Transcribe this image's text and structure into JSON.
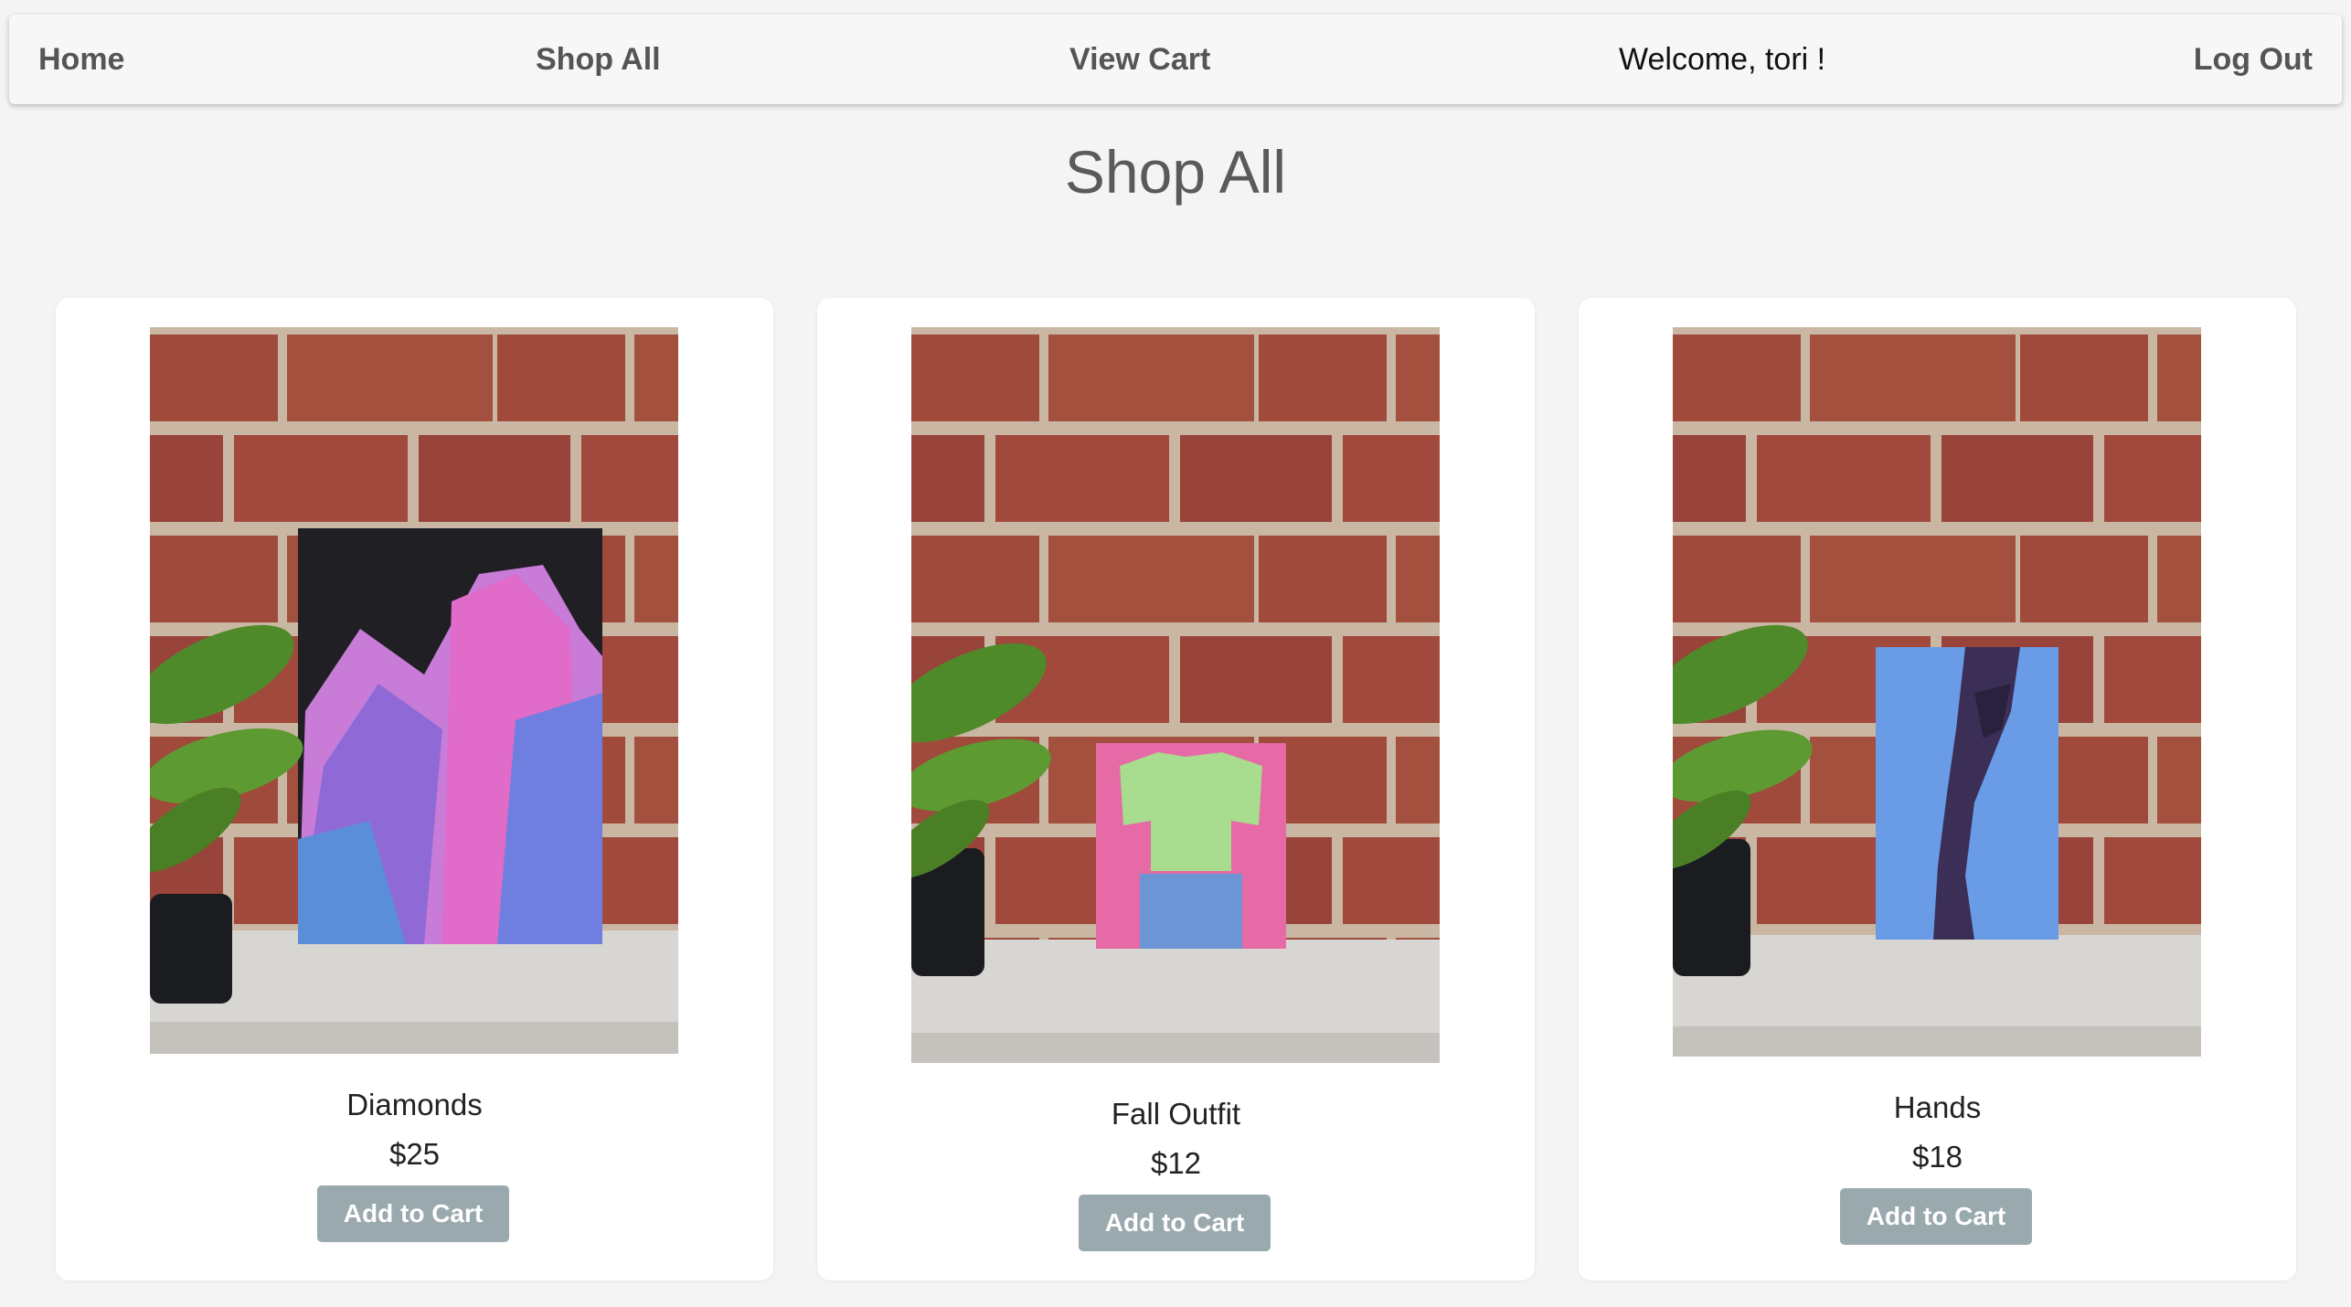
{
  "nav": {
    "home": "Home",
    "shop_all": "Shop All",
    "view_cart": "View Cart",
    "welcome": "Welcome, tori !",
    "logout": "Log Out"
  },
  "page": {
    "title": "Shop All"
  },
  "products": [
    {
      "name": "Diamonds",
      "price": "$25",
      "button": "Add to Cart",
      "image": "crystals-artwork-photo"
    },
    {
      "name": "Fall Outfit",
      "price": "$12",
      "button": "Add to Cart",
      "image": "outfit-artwork-photo"
    },
    {
      "name": "Hands",
      "price": "$18",
      "button": "Add to Cart",
      "image": "hands-artwork-photo"
    }
  ],
  "colors": {
    "page_bg": "#f4f4f4",
    "navbar_bg": "#f7f7f7",
    "button_bg": "#9aa9ae",
    "brick": "#9e4a3a",
    "mortar": "#c9b7a4"
  }
}
